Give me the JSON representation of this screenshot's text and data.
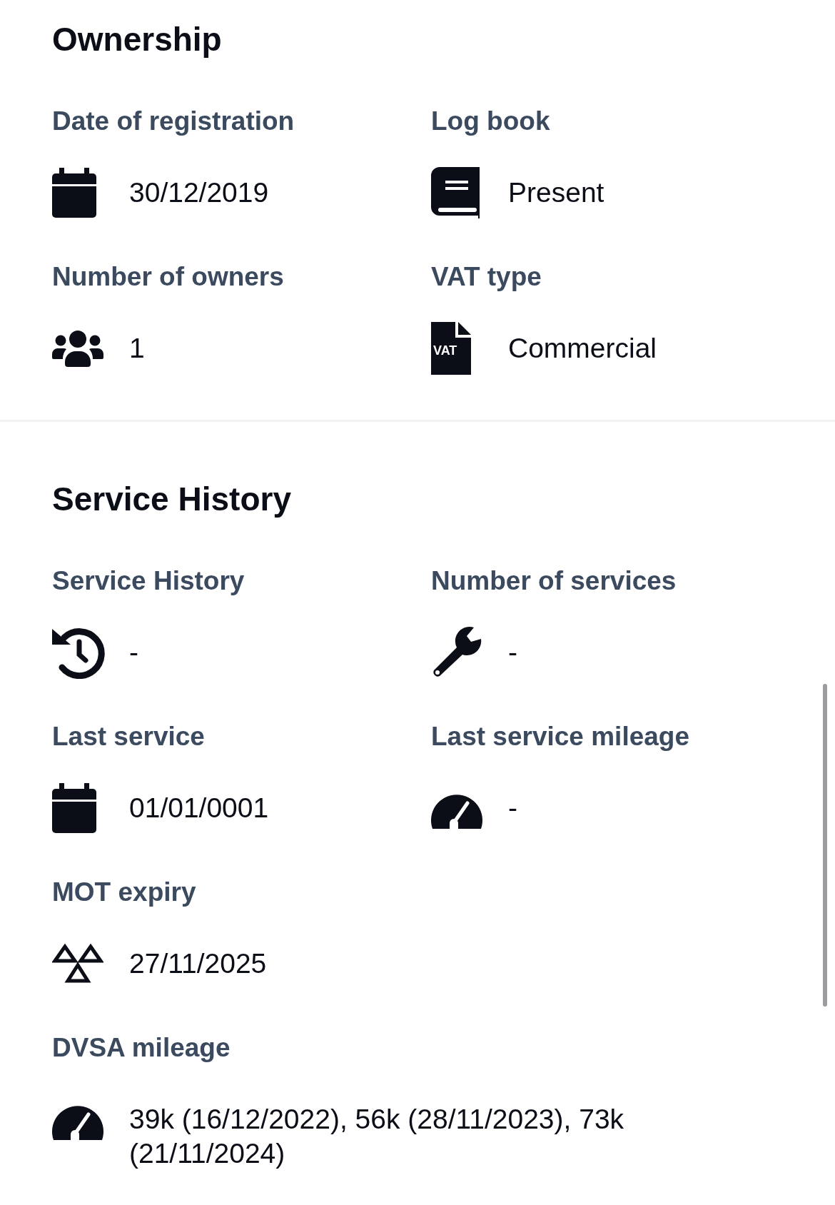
{
  "sections": [
    {
      "title": "Ownership",
      "rows": [
        [
          {
            "label": "Date of registration",
            "kind": "calendar",
            "value": "30/12/2019"
          },
          {
            "label": "Log book",
            "kind": "book",
            "value": "Present"
          }
        ],
        [
          {
            "label": "Number of owners",
            "kind": "users",
            "value": "1"
          },
          {
            "label": "VAT type",
            "kind": "vat",
            "icon_text": "VAT",
            "value": "Commercial"
          }
        ]
      ]
    },
    {
      "title": "Service History",
      "rows": [
        [
          {
            "label": "Service History",
            "kind": "history",
            "value": "-"
          },
          {
            "label": "Number of services",
            "kind": "wrench",
            "value": "-"
          }
        ],
        [
          {
            "label": "Last service",
            "kind": "calendar",
            "value": "01/01/0001"
          },
          {
            "label": "Last service mileage",
            "kind": "gauge",
            "value": "-"
          }
        ],
        [
          {
            "label": "MOT expiry",
            "kind": "mot",
            "value": "27/11/2025"
          }
        ],
        [
          {
            "label": "DVSA mileage",
            "kind": "gauge",
            "value": "39k (16/12/2022), 56k (28/11/2023), 73k (21/11/2024)"
          }
        ]
      ]
    }
  ]
}
